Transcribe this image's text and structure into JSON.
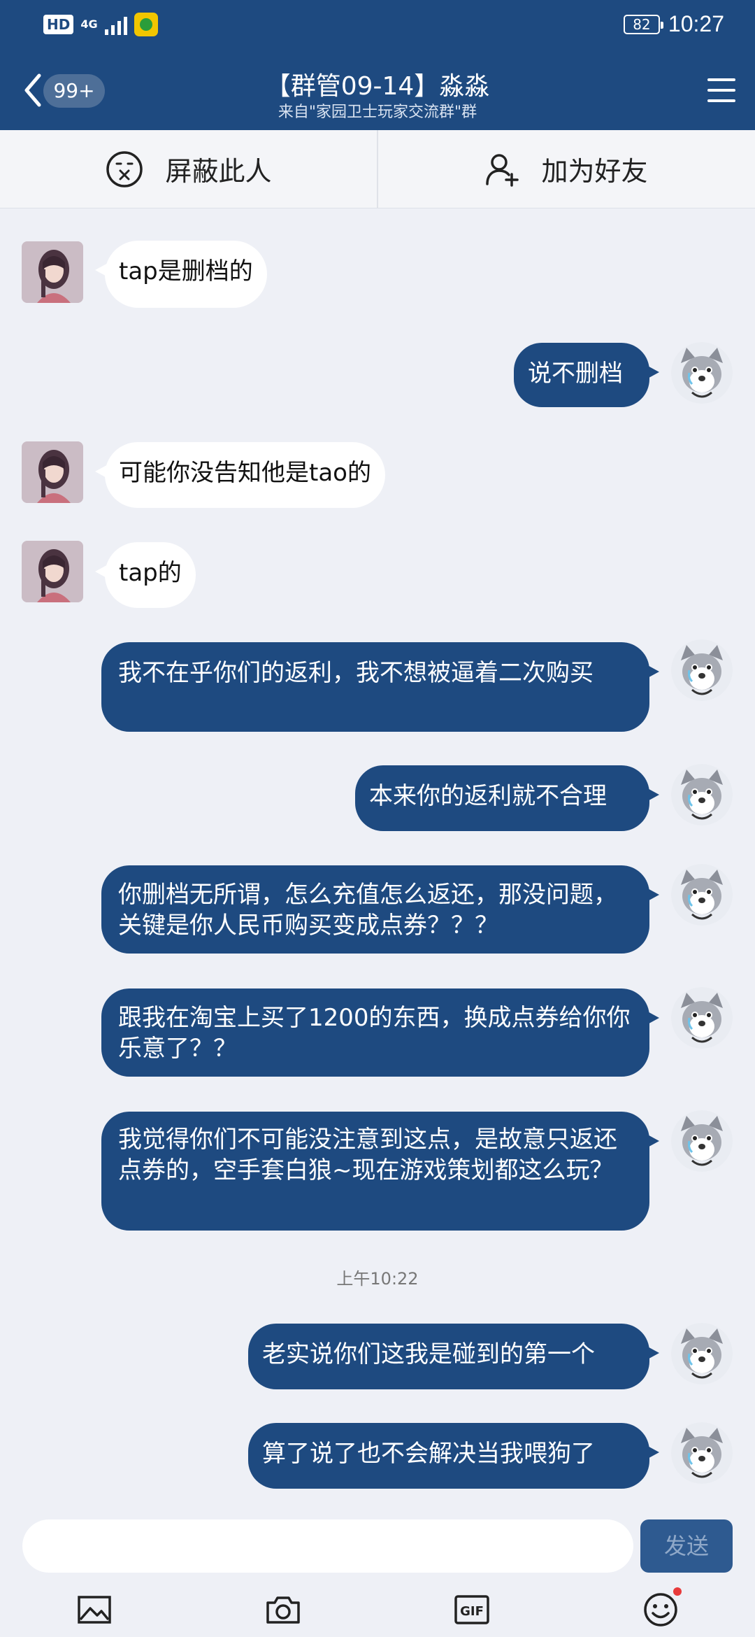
{
  "status_bar": {
    "hd": "HD",
    "network": "4G",
    "battery": "82",
    "time": "10:27"
  },
  "header": {
    "badge": "99+",
    "title": "【群管09-14】淼淼",
    "subtitle": "来自\"家园卫士玩家交流群\"群",
    "accent_color": "#1e4a80"
  },
  "actions": {
    "block_label": "屏蔽此人",
    "add_friend_label": "加为好友"
  },
  "messages": [
    {
      "side": "in",
      "text": "tap是删档的"
    },
    {
      "side": "out",
      "text": "说不删档"
    },
    {
      "side": "in",
      "text": "可能你没告知他是tao的"
    },
    {
      "side": "in",
      "text": "tap的"
    },
    {
      "side": "out",
      "text": "我不在乎你们的返利，我不想被逼着二次购买"
    },
    {
      "side": "out",
      "text": "本来你的返利就不合理"
    },
    {
      "side": "out",
      "text": "你删档无所谓，怎么充值怎么返还，那没问题，关键是你人民币购买变成点券？？？"
    },
    {
      "side": "out",
      "text": "跟我在淘宝上买了1200的东西，换成点券给你你乐意了？？"
    },
    {
      "side": "out",
      "text": "我觉得你们不可能没注意到这点，是故意只返还点券的，空手套白狼~现在游戏策划都这么玩？"
    },
    {
      "side": "out",
      "text": "老实说你们这我是碰到的第一个"
    },
    {
      "side": "out",
      "text": "算了说了也不会解决当我喂狗了"
    }
  ],
  "timestamp": "上午10:22",
  "input_bar": {
    "placeholder": "",
    "send_label": "发送"
  },
  "icons": [
    "back-icon",
    "menu-icon",
    "block-icon",
    "add-friend-icon",
    "image-icon",
    "camera-icon",
    "gif-icon",
    "emoji-icon"
  ]
}
